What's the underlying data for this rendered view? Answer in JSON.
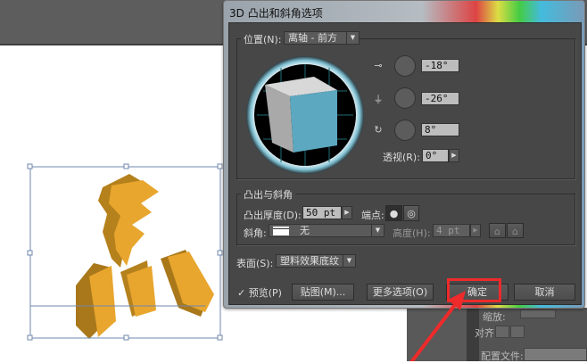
{
  "dialog": {
    "title": "3D 凸出和斜角选项",
    "position": {
      "label": "位置(N):",
      "value": "离轴 - 前方",
      "rotation_x": "-18°",
      "rotation_y": "-26°",
      "rotation_z": "8°",
      "perspective_label": "透视(R):",
      "perspective": "0°"
    },
    "extrude": {
      "group_label": "凸出与斜角",
      "depth_label": "凸出厚度(D):",
      "depth": "50 pt",
      "cap_label": "端点:",
      "bevel_label": "斜角:",
      "bevel": "无",
      "height_label": "高度(H):",
      "height": "4 pt"
    },
    "surface": {
      "label": "表面(S):",
      "value": "塑料效果底纹"
    },
    "buttons": {
      "preview": "预览(P)",
      "map": "贴图(M)...",
      "more": "更多选项(O)",
      "ok": "确定",
      "cancel": "取消"
    },
    "preview_checked": true
  },
  "right_panel": {
    "scale_label": "缩放:",
    "align_label": "对齐:",
    "profile_label": "配置文件:"
  },
  "colors": {
    "highlight": "#ee2a2a",
    "cube_front": "#5ba8c0",
    "text_art": "#e8a62e"
  }
}
